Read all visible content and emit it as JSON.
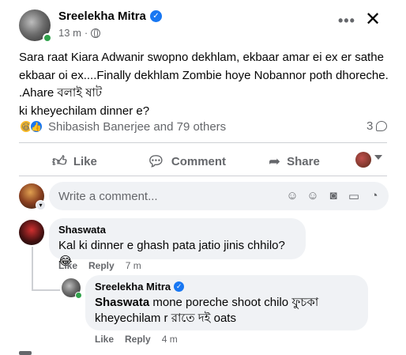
{
  "post": {
    "author": "Sreelekha Mitra",
    "time": "13 m",
    "privacy_separator": "·",
    "text": "Sara raat Kiara Adwanir swopno dekhlam, ekbaar amar ei ex er sathe ekbaar oi ex....Finally dekhlam Zombie hoye Nobannor poth dhoreche. .Ahare বলাই ষাট\n ki kheyechilam dinner e?",
    "reactions_summary": "Shibasish Banerjee and 79 others",
    "comment_count": "3",
    "more_icon": "more-horizontal-icon",
    "close_icon": "close-icon"
  },
  "actions": {
    "like": "Like",
    "comment": "Comment",
    "share": "Share"
  },
  "composer": {
    "placeholder": "Write a comment..."
  },
  "comments": [
    {
      "author": "Shaswata",
      "text": "Kal ki dinner e ghash pata jatio jinis chhilo?😂",
      "like": "Like",
      "reply": "Reply",
      "time": "7 m"
    }
  ],
  "reply": {
    "author": "Sreelekha Mitra",
    "mention": "Shaswata",
    "text_line1": " mone poreche shoot chilo ফুচকা",
    "text_line2": "kheyechilam r রাতে দই oats",
    "like": "Like",
    "reply": "Reply",
    "time": "4 m"
  },
  "colors": {
    "accent": "#1877f2",
    "online": "#31a24c",
    "bubble": "#f0f2f5",
    "muted": "#65676b"
  }
}
